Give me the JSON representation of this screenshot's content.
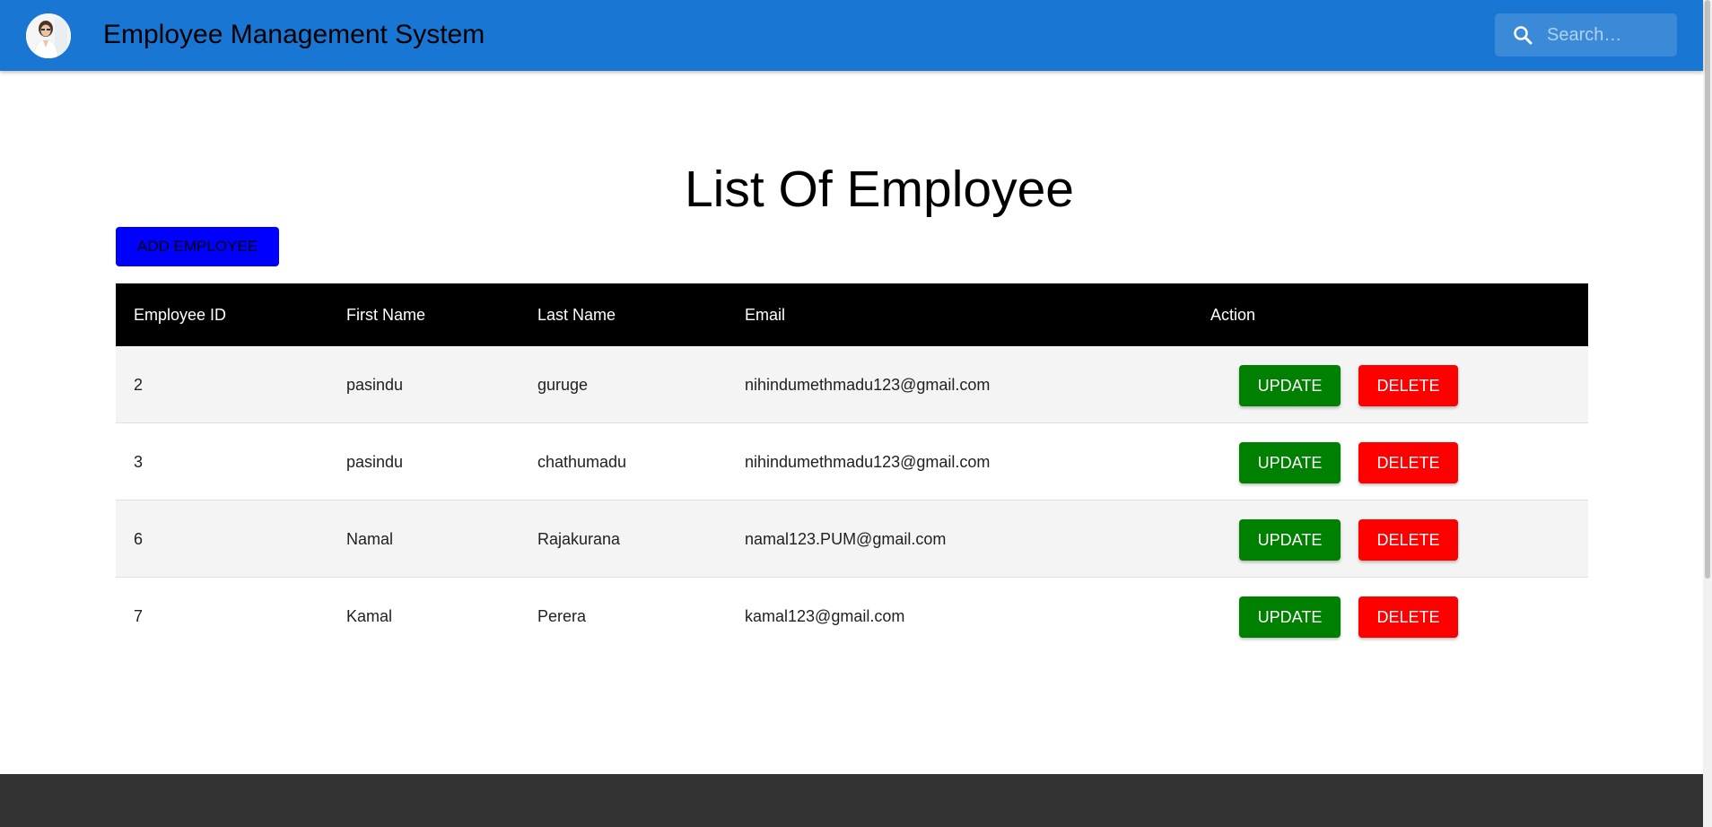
{
  "header": {
    "title": "Employee Management System",
    "avatar_icon": "user-avatar-icon",
    "search": {
      "placeholder": "Search…",
      "value": "",
      "icon": "search-icon"
    },
    "color": "#1976d2"
  },
  "main": {
    "heading": "List Of Employee",
    "add_button_label": "ADD EMPLOYEE",
    "add_button_color": "#0000ff"
  },
  "table": {
    "columns": [
      "Employee ID",
      "First Name",
      "Last Name",
      "Email",
      "Action"
    ],
    "rows": [
      {
        "id": "2",
        "first_name": "pasindu",
        "last_name": "guruge",
        "email": "nihindumethmadu123@gmail.com"
      },
      {
        "id": "3",
        "first_name": "pasindu",
        "last_name": "chathumadu",
        "email": "nihindumethmadu123@gmail.com"
      },
      {
        "id": "6",
        "first_name": "Namal",
        "last_name": "Rajakurana",
        "email": "namal123.PUM@gmail.com"
      },
      {
        "id": "7",
        "first_name": "Kamal",
        "last_name": "Perera",
        "email": "kamal123@gmail.com"
      }
    ],
    "update_label": "UPDATE",
    "delete_label": "DELETE",
    "update_color": "#008000",
    "delete_color": "#ff0000",
    "header_color": "#000000"
  },
  "footer": {
    "color": "#333333"
  }
}
